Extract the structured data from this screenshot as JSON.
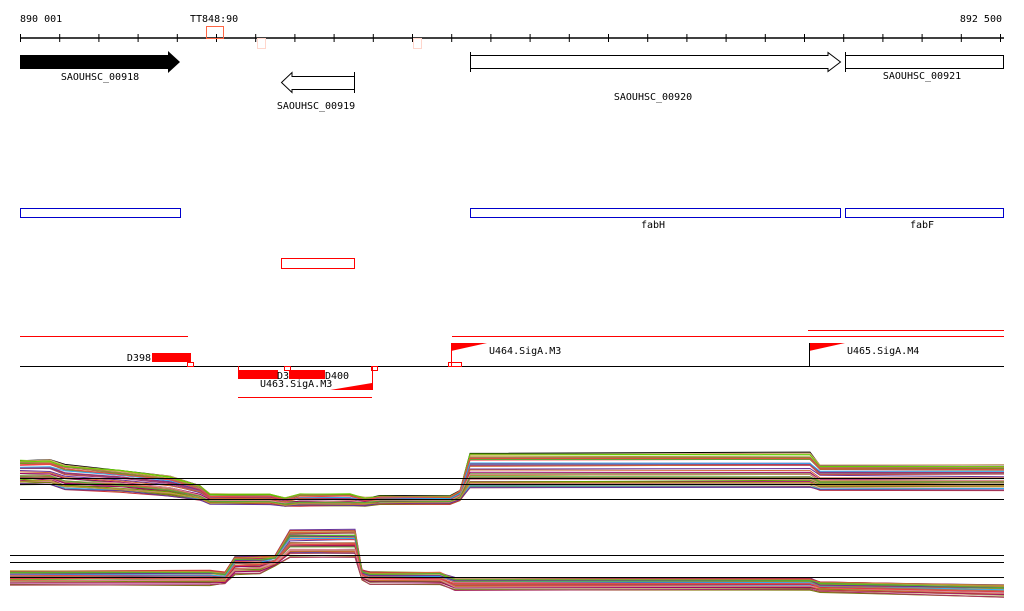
{
  "ruler": {
    "start_label": "890 001",
    "end_label": "892 500",
    "marker_label": "TT848:90"
  },
  "genes": [
    {
      "name": "SAOUHSC_00918",
      "strand": "+",
      "filled": true
    },
    {
      "name": "SAOUHSC_00919",
      "strand": "-",
      "filled": false
    },
    {
      "name": "SAOUHSC_00920",
      "strand": "+",
      "filled": false
    },
    {
      "name": "SAOUHSC_00921",
      "strand": "+",
      "filled": false
    }
  ],
  "gene_symbols": [
    "fabH",
    "fabF"
  ],
  "features": {
    "d398": "D398",
    "d399": "D3",
    "d400": "D400",
    "u463": "U463.SigA.M3",
    "u464": "U464.SigA.M3",
    "u465": "U465.SigA.M4"
  },
  "colors": {
    "feature_red": "#ff0000",
    "box_blue": "#0000cc",
    "marker_orange": "#ff6644",
    "faint_pink": "#ffd6cc"
  }
}
